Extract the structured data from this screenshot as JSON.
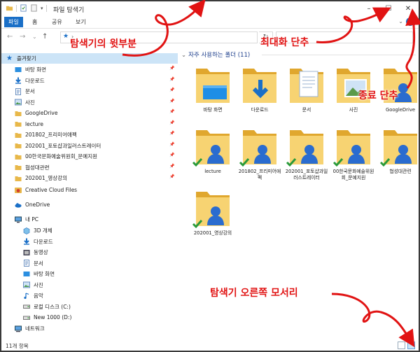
{
  "window": {
    "title": "파일 탐색기",
    "minimize_glyph": "–",
    "maximize_glyph": "☐",
    "close_glyph": "✕"
  },
  "ribbon": {
    "tabs": [
      "파일",
      "홈",
      "공유",
      "보기"
    ],
    "active_tab": "파일",
    "accent": "#1a6fc7"
  },
  "address": {
    "back": "←",
    "forward": "→",
    "recent": "⌄",
    "up": "↑",
    "separator": "›",
    "refresh": "↻"
  },
  "nav": {
    "quick_access_label": "즐겨찾기",
    "quick_access_items": [
      {
        "label": "바탕 화면",
        "icon": "desktop-icon"
      },
      {
        "label": "다운로드",
        "icon": "download-icon"
      },
      {
        "label": "문서",
        "icon": "document-icon"
      },
      {
        "label": "사진",
        "icon": "picture-icon"
      },
      {
        "label": "GoogleDrive",
        "icon": "folder-icon"
      },
      {
        "label": "lecture",
        "icon": "folder-icon"
      },
      {
        "label": "201802_프리미어애펙",
        "icon": "folder-icon"
      },
      {
        "label": "202001_포토샵과일러스트레이터",
        "icon": "folder-icon"
      },
      {
        "label": "00한국문화예술위원회_문예지원",
        "icon": "folder-icon"
      },
      {
        "label": "협성대관련",
        "icon": "folder-icon"
      },
      {
        "label": "202001_영상강의",
        "icon": "folder-icon"
      }
    ],
    "creative_cloud_label": "Creative Cloud Files",
    "onedrive_label": "OneDrive",
    "this_pc_label": "내 PC",
    "this_pc_items": [
      {
        "label": "3D 개체",
        "icon": "3d-objects-icon"
      },
      {
        "label": "다운로드",
        "icon": "download-icon"
      },
      {
        "label": "동영상",
        "icon": "video-icon"
      },
      {
        "label": "문서",
        "icon": "document-icon"
      },
      {
        "label": "바탕 화면",
        "icon": "desktop-icon"
      },
      {
        "label": "사진",
        "icon": "picture-icon"
      },
      {
        "label": "음악",
        "icon": "music-icon"
      },
      {
        "label": "로컬 디스크 (C:)",
        "icon": "drive-icon"
      },
      {
        "label": "New 1000 (D:)",
        "icon": "drive-icon"
      }
    ],
    "network_label": "네트워크"
  },
  "content": {
    "group_title": "자주 사용하는 폴더 (11)",
    "items": [
      {
        "label": "바탕 화면",
        "type": "desktop"
      },
      {
        "label": "다운로드",
        "type": "download"
      },
      {
        "label": "문서",
        "type": "document"
      },
      {
        "label": "사진",
        "type": "picture"
      },
      {
        "label": "GoogleDrive",
        "type": "gdrive"
      },
      {
        "label": "lecture",
        "type": "shared"
      },
      {
        "label": "201802_프리미어애펙",
        "type": "shared"
      },
      {
        "label": "202001_포토샵과일러스트레이터",
        "type": "shared"
      },
      {
        "label": "00한국문화예술위원회_문예지원",
        "type": "shared"
      },
      {
        "label": "협성대관련",
        "type": "shared"
      },
      {
        "label": "202001_영상강의",
        "type": "shared"
      }
    ]
  },
  "status": {
    "count": "11개 항목"
  },
  "annotations": {
    "title_area": "탐색기의 윗부분",
    "maximize": "최대화 단추",
    "close": "종료 단추",
    "corner": "탐색기 오른쪽 모서리",
    "color": "#e11313"
  }
}
